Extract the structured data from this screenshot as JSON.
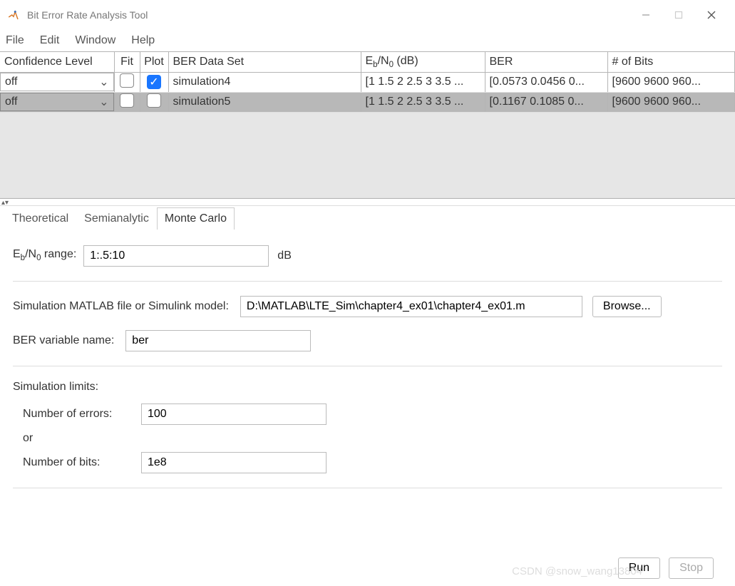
{
  "window": {
    "title": "Bit Error Rate Analysis Tool"
  },
  "menu": {
    "file": "File",
    "edit": "Edit",
    "window": "Window",
    "help": "Help"
  },
  "grid": {
    "headers": {
      "confidence": "Confidence Level",
      "fit": "Fit",
      "plot": "Plot",
      "dataset": "BER Data Set",
      "ebno": "E_b/N_0 (dB)",
      "ber": "BER",
      "bits": "# of Bits"
    },
    "rows": [
      {
        "confidence": "off",
        "fit": false,
        "plot": true,
        "dataset": "simulation4",
        "ebno": "[1 1.5 2 2.5 3 3.5 ...",
        "ber": "[0.0573  0.0456  0...",
        "bits": "[9600  9600  960..."
      },
      {
        "confidence": "off",
        "fit": false,
        "plot": false,
        "dataset": "simulation5",
        "ebno": "[1 1.5 2 2.5 3 3.5 ...",
        "ber": "[0.1167  0.1085  0...",
        "bits": "[9600  9600  960..."
      }
    ]
  },
  "tabs": {
    "theoretical": "Theoretical",
    "semianalytic": "Semianalytic",
    "montecarlo": "Monte Carlo"
  },
  "mc": {
    "ebno_label_pre": "E",
    "ebno_label_post": " range:",
    "ebno_value": "1:.5:10",
    "ebno_unit": "dB",
    "simfile_label": "Simulation MATLAB file or Simulink model:",
    "simfile_value": "D:\\MATLAB\\LTE_Sim\\chapter4_ex01\\chapter4_ex01.m",
    "browse": "Browse...",
    "bervar_label": "BER variable name:",
    "bervar_value": "ber",
    "limits_label": "Simulation limits:",
    "nerr_label": "Number of errors:",
    "nerr_value": "100",
    "or_label": "or",
    "nbits_label": "Number of bits:",
    "nbits_value": "1e8",
    "run": "Run",
    "stop": "Stop"
  },
  "watermark": "CSDN @snow_wang13804"
}
